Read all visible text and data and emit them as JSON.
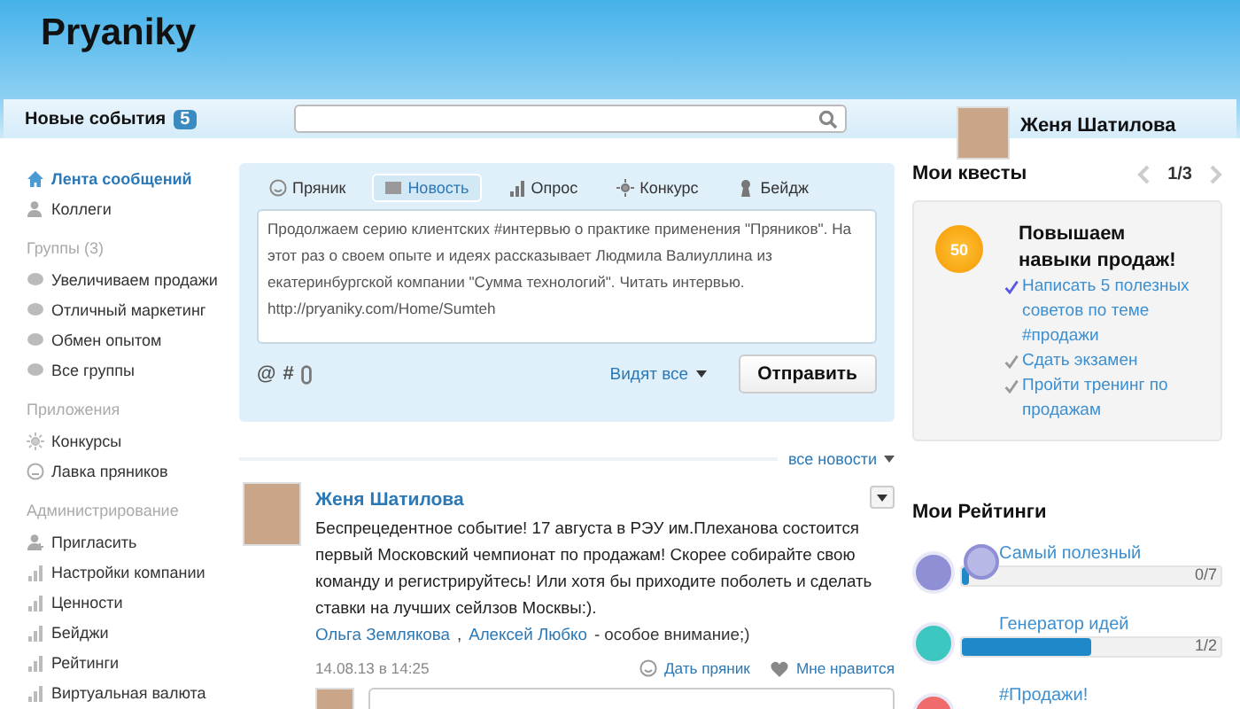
{
  "header": {
    "logo": "Pryaniky",
    "events_label": "Новые события",
    "events_count": "5",
    "user_name": "Женя Шатилова"
  },
  "sidebar": {
    "items": [
      {
        "kind": "home",
        "label": "Лента сообщений",
        "selected": true
      },
      {
        "kind": "people",
        "label": "Коллеги",
        "selected": false
      },
      {
        "kind": "heading",
        "label": "Группы (3)"
      },
      {
        "kind": "group",
        "label": "Увеличиваем продажи",
        "selected": false
      },
      {
        "kind": "group",
        "label": "Отличный маркетинг",
        "selected": false
      },
      {
        "kind": "group",
        "label": "Обмен опытом",
        "selected": false
      },
      {
        "kind": "group",
        "label": "Все группы",
        "selected": false
      },
      {
        "kind": "heading",
        "label": "Приложения"
      },
      {
        "kind": "contest",
        "label": "Конкурсы",
        "selected": false
      },
      {
        "kind": "shop",
        "label": "Лавка пряников",
        "selected": false
      },
      {
        "kind": "heading",
        "label": "Администрирование"
      },
      {
        "kind": "invite",
        "label": "Пригласить",
        "selected": false
      },
      {
        "kind": "setting",
        "label": "Настройки компании",
        "selected": false
      },
      {
        "kind": "setting",
        "label": "Ценности",
        "selected": false
      },
      {
        "kind": "setting",
        "label": "Бейджи",
        "selected": false
      },
      {
        "kind": "setting",
        "label": "Рейтинги",
        "selected": false
      },
      {
        "kind": "setting",
        "label": "Виртуальная валюта",
        "selected": false
      }
    ]
  },
  "composer": {
    "tabs": [
      {
        "kind": "smile",
        "label": "Пряник",
        "selected": false
      },
      {
        "kind": "news",
        "label": "Новость",
        "selected": true
      },
      {
        "kind": "poll",
        "label": "Опрос",
        "selected": false
      },
      {
        "kind": "contest",
        "label": "Конкурс",
        "selected": false
      },
      {
        "kind": "badge",
        "label": "Бейдж",
        "selected": false
      }
    ],
    "text": "Продолжаем серию клиентских #интервью о практике применения \"Пряников\". На этот раз о своем опыте и идеях рассказывает Людмила Валиуллина из екатеринбургской компании \"Сумма технологий\". Читать интервью. http://pryaniky.com/Home/Sumteh",
    "tools": [
      "@",
      "#"
    ],
    "visibility": "Видят все",
    "send": "Отправить"
  },
  "feed": {
    "filter": "все новости",
    "post": {
      "author": "Женя Шатилова",
      "text": "Беспрецедентное событие! 17 августа в РЭУ им.Плеханова состоится первый Московский чемпионат по продажам! Скорее собирайте свою команду и регистрируйтесь! Или хотя бы приходите поболеть и сделать ставки на лучших сейлзов Москвы:).",
      "mentions": [
        "Ольга Землякова",
        "Алексей Любко"
      ],
      "mention_separator": ",",
      "mention_note": "- особое внимание;)",
      "date": "14.08.13 в 14:25",
      "give": "Дать пряник",
      "like": "Мне нравится"
    }
  },
  "quests": {
    "title": "Мои квесты",
    "page": "1/3",
    "points": "50",
    "name": "Повышаем навыки продаж!",
    "tasks": [
      {
        "label": "Написать 5 полезных советов по теме #продажи",
        "checked": true
      },
      {
        "label": "Сдать экзамен",
        "checked": false
      },
      {
        "label": "Пройти тренинг по продажам",
        "checked": false
      }
    ]
  },
  "ratings": {
    "title": "Мои Рейтинги",
    "items": [
      {
        "label": "Самый полезный",
        "level": 0.03,
        "reading": "0/7",
        "color": "#8f8fd6"
      },
      {
        "label": "Генератор идей",
        "level": 0.5,
        "reading": "1/2",
        "color": "#3cc8c0"
      },
      {
        "label": "#Продажи!",
        "color": "#f06b6b"
      }
    ]
  }
}
